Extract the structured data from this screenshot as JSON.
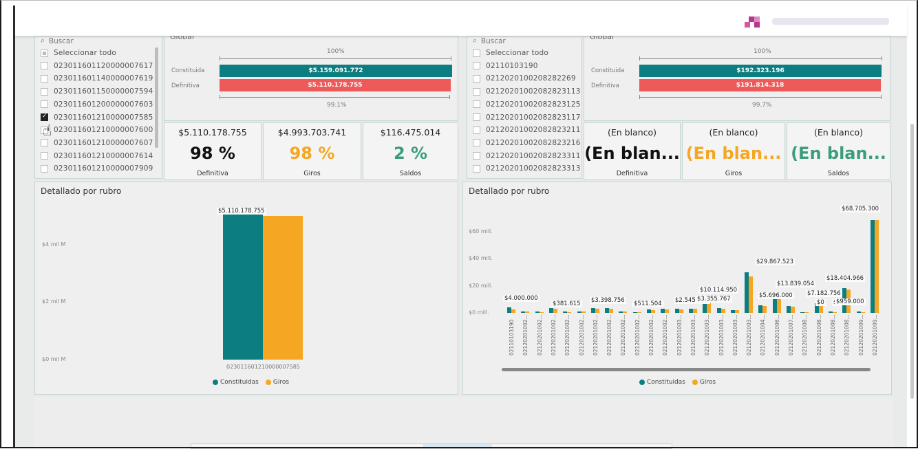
{
  "colors": {
    "teal": "#0c7d80",
    "orange": "#f5a623",
    "salmon": "#ee5a5a",
    "green_kpi": "#3a9d7d"
  },
  "left": {
    "slicer": {
      "search_placeholder": "Buscar",
      "items": [
        {
          "label": "Seleccionar todo",
          "state": "partial"
        },
        {
          "label": "023011601120000007617",
          "state": "off"
        },
        {
          "label": "023011601140000007619",
          "state": "off"
        },
        {
          "label": "023011601150000007594",
          "state": "off"
        },
        {
          "label": "023011601200000007603",
          "state": "off"
        },
        {
          "label": "023011601210000007585",
          "state": "on"
        },
        {
          "label": "023011601210000007600",
          "state": "off"
        },
        {
          "label": "023011601210000007607",
          "state": "off"
        },
        {
          "label": "023011601210000007614",
          "state": "off"
        },
        {
          "label": "023011601210000007909",
          "state": "off"
        }
      ]
    },
    "global": {
      "title": "Global",
      "top_pct": "100%",
      "bottom_pct": "99.1%",
      "bar1_label": "Constituida",
      "bar1_value": "$5.159.091.772",
      "bar2_label": "Definitiva",
      "bar2_value": "$5.110.178.755"
    },
    "kpis": [
      {
        "top": "$5.110.178.755",
        "big": "98 %",
        "label": "Definitiva",
        "color": "#111111"
      },
      {
        "top": "$4.993.703.741",
        "big": "98 %",
        "label": "Giros",
        "color": "#f5a623"
      },
      {
        "top": "$116.475.014",
        "big": "2 %",
        "label": "Saldos",
        "color": "#3a9d7d"
      }
    ],
    "chart_title": "Detallado por rubro"
  },
  "right": {
    "slicer": {
      "search_placeholder": "Buscar",
      "items": [
        {
          "label": "Seleccionar todo",
          "state": "off"
        },
        {
          "label": "02110103190",
          "state": "off"
        },
        {
          "label": "0212020100208282269",
          "state": "off"
        },
        {
          "label": "02120201002082823113",
          "state": "off"
        },
        {
          "label": "02120201002082823125",
          "state": "off"
        },
        {
          "label": "02120201002082823117",
          "state": "off"
        },
        {
          "label": "02120201002082823211",
          "state": "off"
        },
        {
          "label": "02120201002082823216",
          "state": "off"
        },
        {
          "label": "02120201002082823311",
          "state": "off"
        },
        {
          "label": "02120201002082823313",
          "state": "off"
        }
      ]
    },
    "global": {
      "title": "Global",
      "top_pct": "100%",
      "bottom_pct": "99.7%",
      "bar1_label": "Constituida",
      "bar1_value": "$192.323.196",
      "bar2_label": "Definitiva",
      "bar2_value": "$191.814.318"
    },
    "kpis": [
      {
        "top": "(En blanco)",
        "big": "(En blan...",
        "label": "Definitiva",
        "color": "#111111"
      },
      {
        "top": "(En blanco)",
        "big": "(En blan...",
        "label": "Giros",
        "color": "#f5a623"
      },
      {
        "top": "(En blanco)",
        "big": "(En blan...",
        "label": "Saldos",
        "color": "#3a9d7d"
      }
    ],
    "chart_title": "Detallado por rubro"
  },
  "chart_data": [
    {
      "type": "bar",
      "title": "Detallado por rubro",
      "categories": [
        "023011601210000007585"
      ],
      "series": [
        {
          "name": "Constituidas",
          "values": [
            5159091772
          ]
        },
        {
          "name": "Giros",
          "values": [
            4993703741
          ]
        }
      ],
      "data_labels": [
        "$5.110.178.755"
      ],
      "y_ticks": [
        "$0 mil M",
        "$2 mil M",
        "$4 mil M"
      ],
      "ylim": [
        0,
        5500000000
      ],
      "legend": [
        "Constituidas",
        "Giros"
      ],
      "legend_position": "bottom"
    },
    {
      "type": "bar",
      "title": "Detallado por rubro",
      "categories": [
        "02110103190",
        "02120201002...",
        "02120201002...",
        "02120201002...",
        "02120201002...",
        "02120201002...",
        "02120201002...",
        "02120201002...",
        "02120201002...",
        "02120201002...",
        "02120201002...",
        "02120201002...",
        "02120201003...",
        "02120201003...",
        "02120201003...",
        "02120201003...",
        "02120201003...",
        "02120201003...",
        "02120201004...",
        "02120201006...",
        "02120201007...",
        "02120201008...",
        "02120201008...",
        "02120201008...",
        "02120201008...",
        "02120201009...",
        "02120201009..."
      ],
      "series": [
        {
          "name": "Constituidas",
          "values": [
            4000000,
            1200000,
            900000,
            3800000,
            1000000,
            1100000,
            3398756,
            3400000,
            1200000,
            511504,
            2545155,
            2800000,
            2900000,
            3100000,
            10114950,
            3355767,
            2000000,
            29867523,
            5696000,
            13839054,
            5000000,
            600000,
            7182756,
            900000,
            18404966,
            959000,
            68705300
          ]
        },
        {
          "name": "Giros",
          "values": [
            2500000,
            800000,
            700000,
            3000000,
            600000,
            900000,
            3000000,
            3200000,
            900000,
            400000,
            2200000,
            2500000,
            2700000,
            2900000,
            9000000,
            3000000,
            1800000,
            27000000,
            5000000,
            11000000,
            4500000,
            0,
            6000000,
            0,
            17000000,
            500000,
            68705300
          ]
        }
      ],
      "data_labels": [
        "$4.000.000",
        "$381.615",
        "$3.398.756",
        "$511.504",
        "$2.545.155",
        "$10.114.950",
        "$3.355.767",
        "$29.867.523",
        "$5.696.000",
        "$13.839.054",
        "$7.182.756",
        "$0",
        "$0",
        "$18.404.966",
        "$959.000",
        "$68.705.300"
      ],
      "y_ticks": [
        "$0 mill.",
        "$20 mill.",
        "$40 mill.",
        "$60 mill."
      ],
      "ylim": [
        0,
        70000000
      ],
      "legend": [
        "Constituidas",
        "Giros"
      ],
      "legend_position": "bottom"
    }
  ]
}
